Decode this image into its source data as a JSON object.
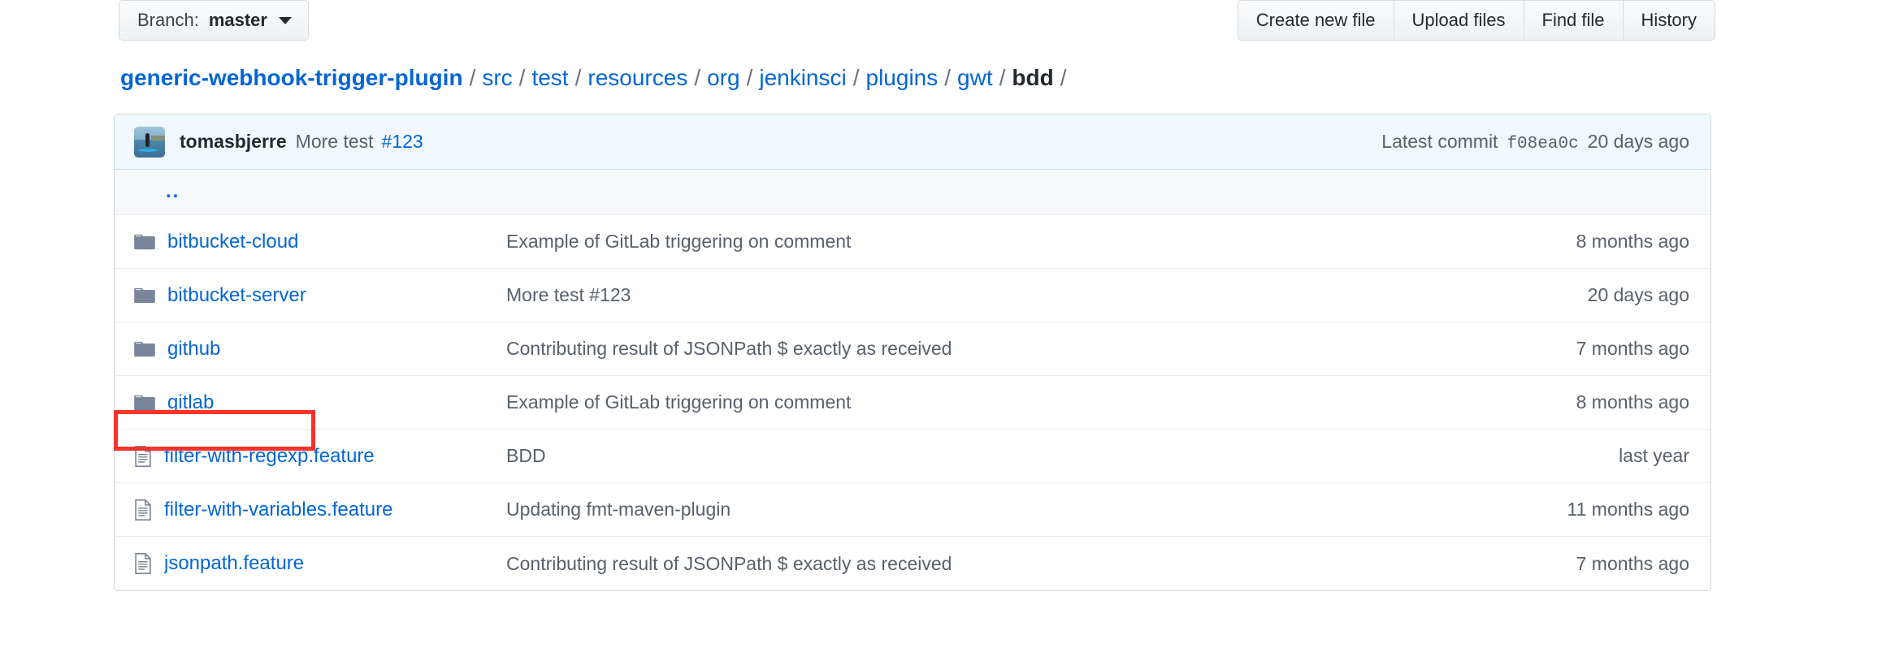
{
  "toolbar": {
    "branch": {
      "label": "Branch:",
      "value": "master",
      "caret_icon": "chevron-down-icon"
    },
    "actions": [
      {
        "label": "Create new file"
      },
      {
        "label": "Upload files"
      },
      {
        "label": "Find file"
      },
      {
        "label": "History"
      }
    ]
  },
  "breadcrumb": {
    "repo": "generic-webhook-trigger-plugin",
    "separator": "/",
    "path": [
      {
        "label": "src",
        "current": false
      },
      {
        "label": "test",
        "current": false
      },
      {
        "label": "resources",
        "current": false
      },
      {
        "label": "org",
        "current": false
      },
      {
        "label": "jenkinsci",
        "current": false
      },
      {
        "label": "plugins",
        "current": false
      },
      {
        "label": "gwt",
        "current": false
      },
      {
        "label": "bdd",
        "current": true
      }
    ]
  },
  "commit_bar": {
    "avatar_icon": "user-avatar",
    "author": "tomasbjerre",
    "message": "More test",
    "issue_ref": "#123",
    "latest_commit_label": "Latest commit",
    "sha": "f08ea0c",
    "age": "20 days ago"
  },
  "file_list": {
    "parent_dir_label": "..",
    "rows": [
      {
        "icon": "folder-icon",
        "type": "folder",
        "name": "bitbucket-cloud",
        "message": "Example of GitLab triggering on comment",
        "age": "8 months ago"
      },
      {
        "icon": "folder-icon",
        "type": "folder",
        "name": "bitbucket-server",
        "message": "More test #123",
        "age": "20 days ago"
      },
      {
        "icon": "folder-icon",
        "type": "folder",
        "name": "github",
        "message": "Contributing result of JSONPath $ exactly as received",
        "age": "7 months ago"
      },
      {
        "icon": "folder-icon",
        "type": "folder",
        "name": "gitlab",
        "message": "Example of GitLab triggering on comment",
        "age": "8 months ago"
      },
      {
        "icon": "file-icon",
        "type": "file",
        "name": "filter-with-regexp.feature",
        "message": "BDD",
        "age": "last year"
      },
      {
        "icon": "file-icon",
        "type": "file",
        "name": "filter-with-variables.feature",
        "message": "Updating fmt-maven-plugin",
        "age": "11 months ago"
      },
      {
        "icon": "file-icon",
        "type": "file",
        "name": "jsonpath.feature",
        "message": "Contributing result of JSONPath $ exactly as received",
        "age": "7 months ago"
      }
    ]
  },
  "annotation": {
    "target": "gitlab",
    "color": "#f9322c",
    "shape": "rectangle"
  },
  "colors": {
    "link": "#0366d6",
    "text": "#24292e",
    "muted": "#586069",
    "border": "#d1d5da",
    "commit_bar_bg": "#f1f8ff",
    "row_alt_bg": "#f6f8fa",
    "folder_icon": "#79869a",
    "annotation": "#f9322c"
  }
}
